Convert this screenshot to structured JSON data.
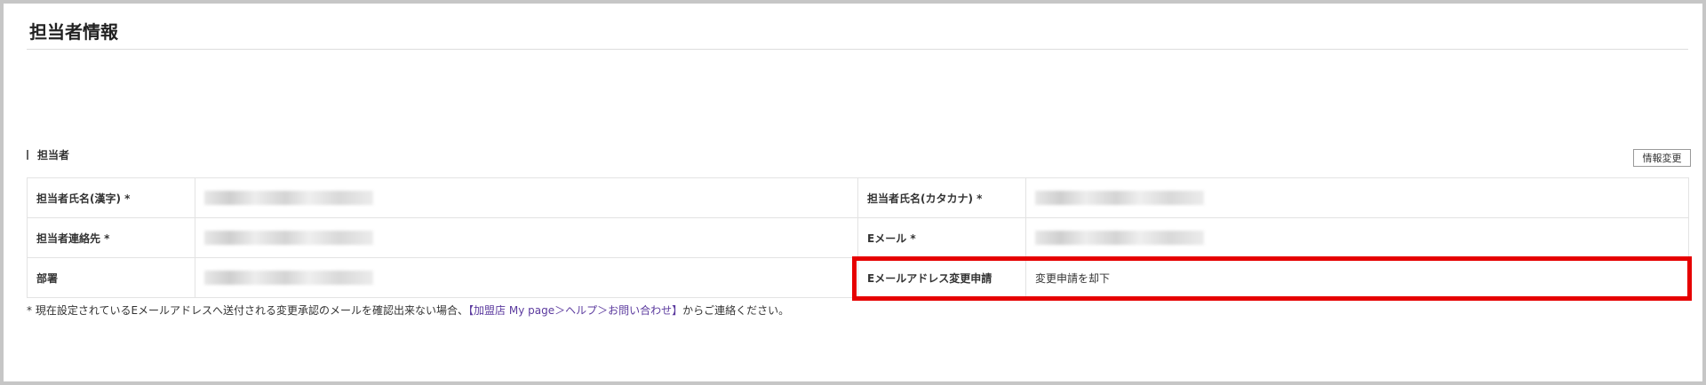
{
  "page": {
    "title": "担当者情報"
  },
  "section": {
    "title": "担当者",
    "edit_button_label": "情報変更"
  },
  "table": {
    "rows": [
      {
        "left_label": "担当者氏名(漢字) *",
        "left_value": "",
        "right_label": "担当者氏名(カタカナ) *",
        "right_value": ""
      },
      {
        "left_label": "担当者連絡先 *",
        "left_value": "",
        "right_label": "Eメール *",
        "right_value": ""
      },
      {
        "left_label": "部署",
        "left_value": "",
        "right_label": "Eメールアドレス変更申請",
        "right_value": "変更申請を却下"
      }
    ]
  },
  "note": {
    "prefix": "* 現在設定されているEメールアドレスへ送付される変更承認のメールを確認出来ない場合、",
    "link": "【加盟店 My page＞ヘルプ＞お問い合わせ】",
    "suffix": "からご連絡ください。"
  },
  "colors": {
    "highlight": "#e60000",
    "link": "#5b3a9e"
  }
}
